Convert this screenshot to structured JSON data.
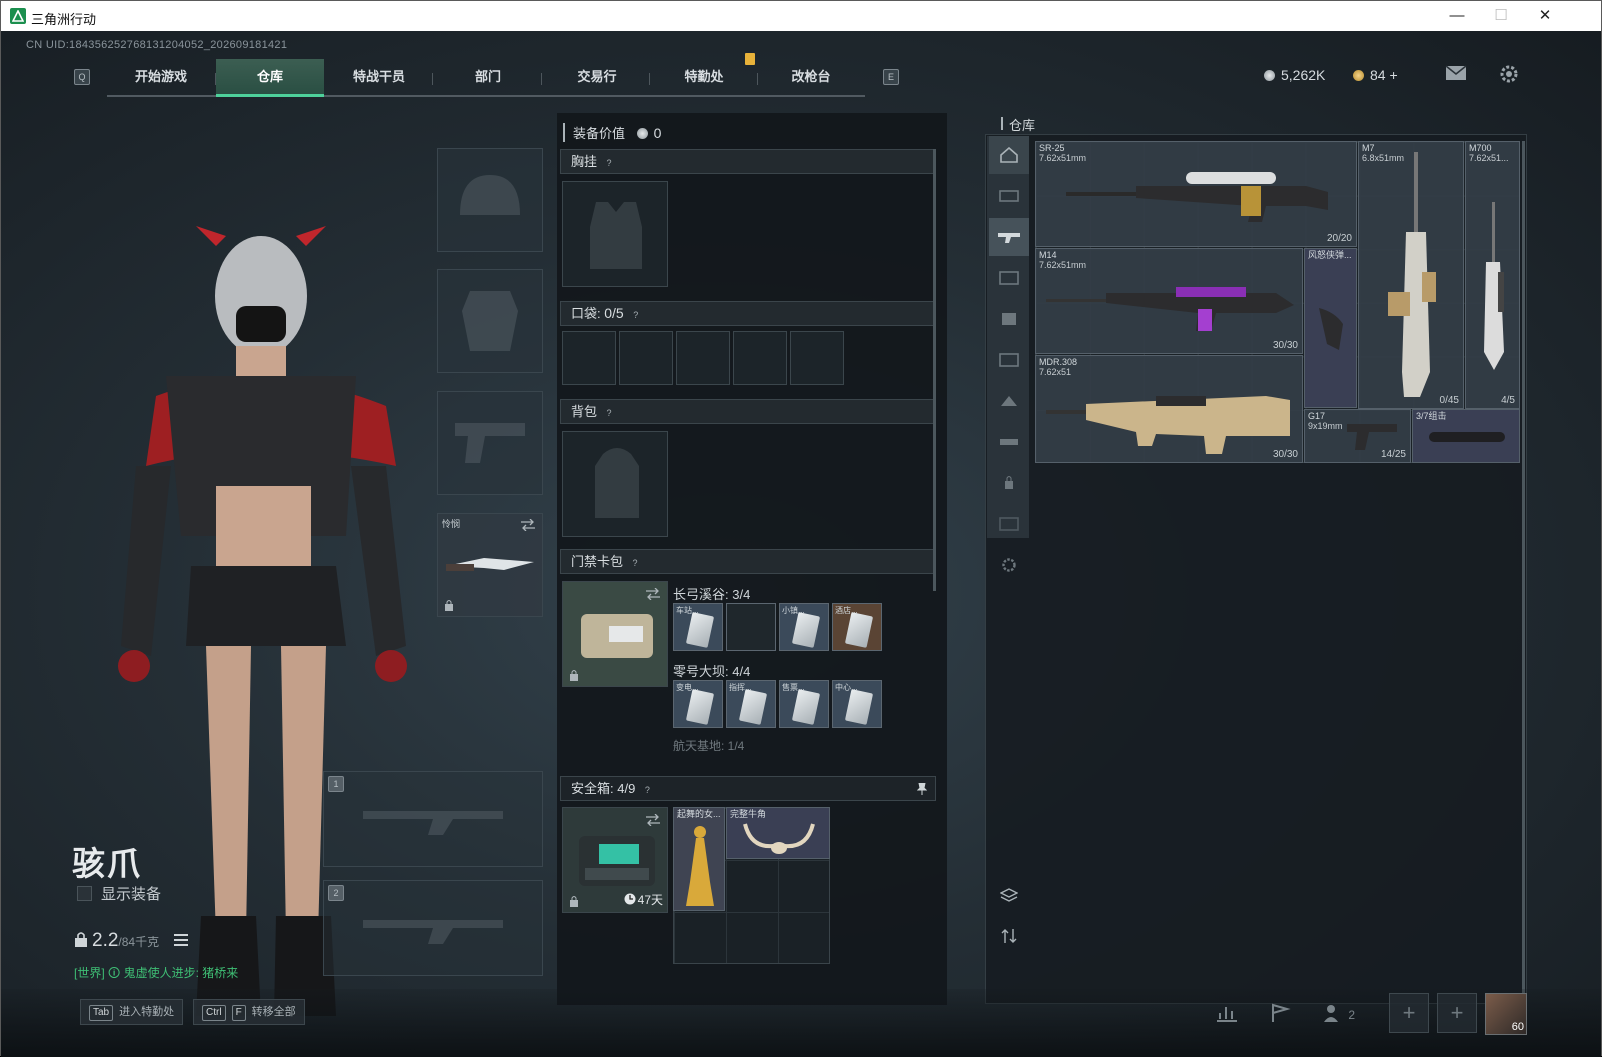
{
  "window": {
    "title": "三角洲行动",
    "minimize": "—",
    "maximize": "☐",
    "close": "✕"
  },
  "uid": "CN UID:18435625276813120405​2_202609181421",
  "nav": {
    "left_key": "Q",
    "right_key": "E",
    "tabs": [
      "开始游戏",
      "仓库",
      "特战干员",
      "部门",
      "交易行",
      "特勤处",
      "改枪台"
    ],
    "active_tab": "仓库"
  },
  "currency": {
    "silver": "5,262K",
    "gold": "84",
    "plus": "+"
  },
  "operator": {
    "name": "骇爪",
    "show_equipment": "显示装备",
    "weight": "2.2",
    "weight_cap": "/84千克",
    "world_msg": "[世界] 🛈 鬼虚使人进步: 猪桥来"
  },
  "gear_slots": {
    "melee_name": "怜悯",
    "weapon_slot_1": "1",
    "weapon_slot_2": "2"
  },
  "loadout": {
    "equip_value_label": "装备价值",
    "equip_value": "0",
    "chest_rig": "胸挂",
    "pockets_label": "口袋:",
    "pockets_count": "0/5",
    "backpack": "背包",
    "keycard_label": "门禁卡包",
    "key_group_1": "长弓溪谷: 3/4",
    "key_group_1_items": [
      "车站...",
      "",
      "小镇...",
      "酒店..."
    ],
    "key_group_2": "零号大坝: 4/4",
    "key_group_2_items": [
      "变电...",
      "指挥...",
      "售票...",
      "中心..."
    ],
    "key_group_3": "航天基地: 1/4",
    "safe_label": "安全箱:",
    "safe_count": "4/9",
    "safe_days": "47天",
    "safe_items": [
      "起舞的女...",
      "完整牛角"
    ]
  },
  "warehouse": {
    "label": "仓库",
    "items": [
      {
        "name": "SR-25",
        "caliber": "7.62x51mm",
        "count": "20/20"
      },
      {
        "name": "M7",
        "caliber": "6.8x51mm",
        "count": "0/45"
      },
      {
        "name": "M700",
        "caliber": "7.62x51...",
        "count": "4/5"
      },
      {
        "name": "M14",
        "caliber": "7.62x51mm",
        "count": "30/30"
      },
      {
        "name": "风怒侠弹...",
        "caliber": "",
        "count": ""
      },
      {
        "name": "MDR.308",
        "caliber": "7.62x51",
        "count": "30/30"
      },
      {
        "name": "G17",
        "caliber": "9x19mm",
        "count": "14/25"
      },
      {
        "name": "3/7组击",
        "caliber": "",
        "count": ""
      }
    ]
  },
  "bottom": {
    "hint1_key": "Tab",
    "hint1": "进入特勤处",
    "hint2_key1": "Ctrl",
    "hint2_key2": "F",
    "hint2": "转移全部",
    "squad_count": "2",
    "level": "60"
  },
  "colors": {
    "accent": "#4ed19b",
    "gold": "#e8b23a",
    "bg": "#1d252b"
  }
}
